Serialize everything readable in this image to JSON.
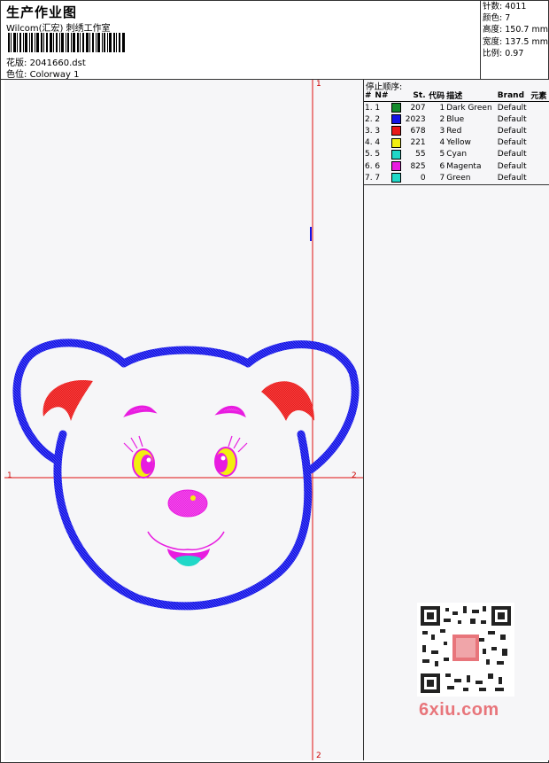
{
  "header": {
    "title": "生产作业图",
    "subtitle": "Wilcom(汇宏) 刺绣工作室",
    "design_file_label": "花版:",
    "design_file": "2041660.dst",
    "colorway_label": "色位:",
    "colorway": "Colorway 1"
  },
  "stats": [
    {
      "label": "针数:",
      "value": "4011"
    },
    {
      "label": "颜色:",
      "value": "7"
    },
    {
      "label": "高度:",
      "value": "150.7 mm"
    },
    {
      "label": "宽度:",
      "value": "137.5 mm"
    },
    {
      "label": "比例:",
      "value": "0.97"
    }
  ],
  "color_table": {
    "title": "停止顺序:",
    "headers": [
      "#",
      "N#",
      "St.",
      "代码",
      "描述",
      "Brand",
      "元素"
    ],
    "rows": [
      {
        "idx": "1.",
        "n": "1",
        "color": "#138a2c",
        "st": "207",
        "code": "1",
        "desc": "Dark Green",
        "brand": "Default"
      },
      {
        "idx": "2.",
        "n": "2",
        "color": "#1414e6",
        "st": "2023",
        "code": "2",
        "desc": "Blue",
        "brand": "Default"
      },
      {
        "idx": "3.",
        "n": "3",
        "color": "#e81818",
        "st": "678",
        "code": "3",
        "desc": "Red",
        "brand": "Default"
      },
      {
        "idx": "4.",
        "n": "4",
        "color": "#f2ef10",
        "st": "221",
        "code": "4",
        "desc": "Yellow",
        "brand": "Default"
      },
      {
        "idx": "5.",
        "n": "5",
        "color": "#20d8c8",
        "st": "55",
        "code": "5",
        "desc": "Cyan",
        "brand": "Default"
      },
      {
        "idx": "6.",
        "n": "6",
        "color": "#e81ce0",
        "st": "825",
        "code": "6",
        "desc": "Magenta",
        "brand": "Default"
      },
      {
        "idx": "7.",
        "n": "7",
        "color": "#20d8c8",
        "st": "0",
        "code": "7",
        "desc": "Green",
        "brand": "Default"
      }
    ]
  },
  "markers": {
    "one": "1",
    "two": "2"
  },
  "watermark": "6xiu.com",
  "colors": {
    "guide": "#e01010",
    "outline": "#1414e6",
    "ear_inner": "#e81818",
    "feature": "#e81ce0",
    "eye": "#f2ef10",
    "tongue": "#20d8c8"
  }
}
